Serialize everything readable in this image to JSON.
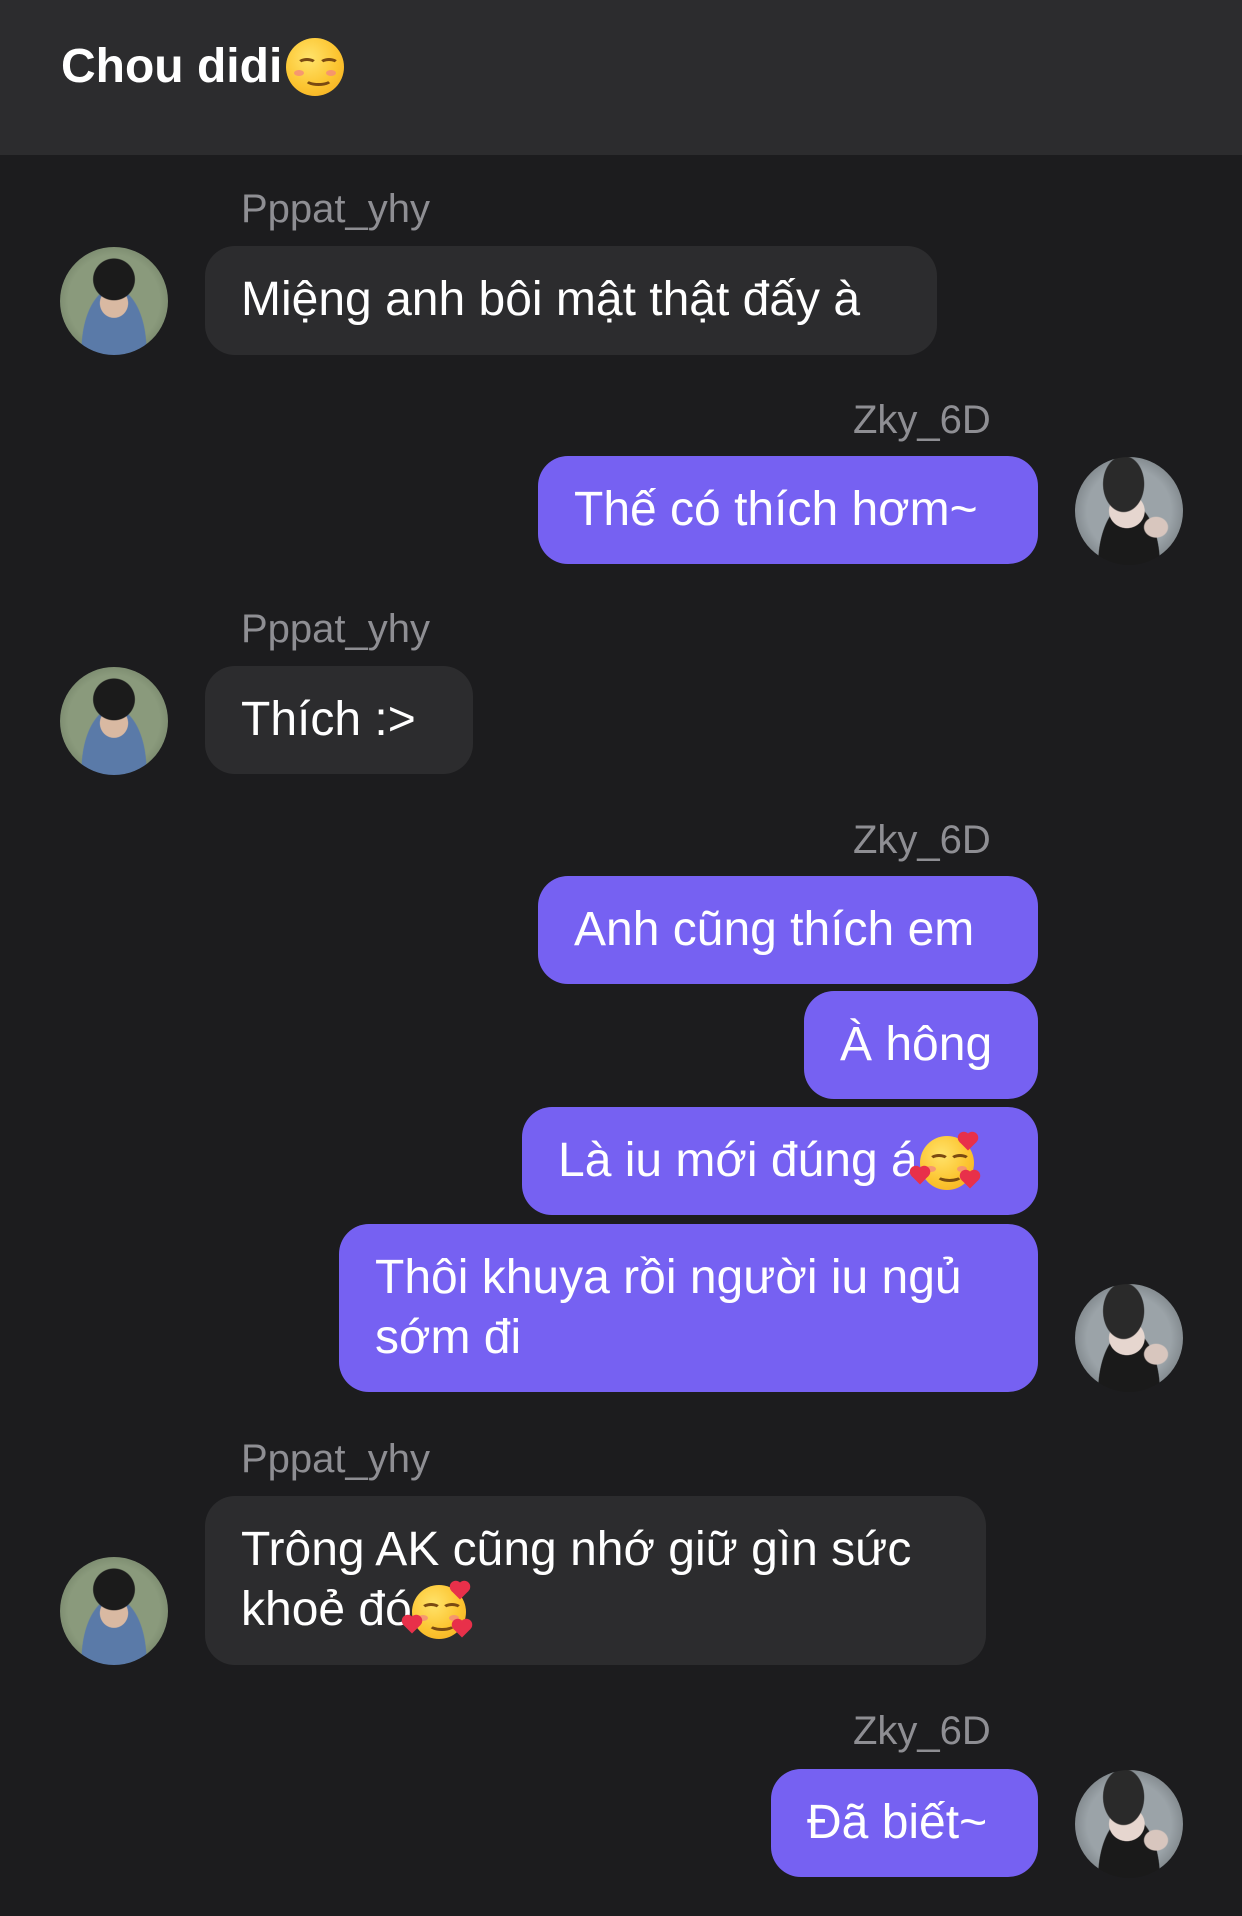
{
  "header": {
    "title": "Chou didi"
  },
  "users": {
    "other": "Pppat_yhy",
    "me": "Zky_6D"
  },
  "messages": [
    {
      "sender": "Pppat_yhy",
      "text": "Miệng anh bôi mật thật đấy à"
    },
    {
      "sender": "Zky_6D",
      "text": "Thế có thích hơm~"
    },
    {
      "sender": "Pppat_yhy",
      "text": "Thích :>"
    },
    {
      "sender": "Zky_6D",
      "text": "Anh cũng thích em"
    },
    {
      "sender": "Zky_6D",
      "text": "À hông"
    },
    {
      "sender": "Zky_6D",
      "text": "Là iu mới đúng á",
      "emoji": "smiling-face-with-hearts"
    },
    {
      "sender": "Zky_6D",
      "text": "Thôi khuya rồi người iu ngủ\nsớm đi"
    },
    {
      "sender": "Pppat_yhy",
      "text": "Trông AK cũng nhớ giữ gìn sức\nkhoẻ đó",
      "emoji": "smiling-face-with-hearts"
    },
    {
      "sender": "Zky_6D",
      "text": "Đã biết~"
    }
  ],
  "colors": {
    "background": "#1c1c1e",
    "header": "#2c2c2e",
    "incoming_bubble": "#2c2c2e",
    "outgoing_bubble": "#7661f2",
    "name_text": "#8e8e93"
  }
}
